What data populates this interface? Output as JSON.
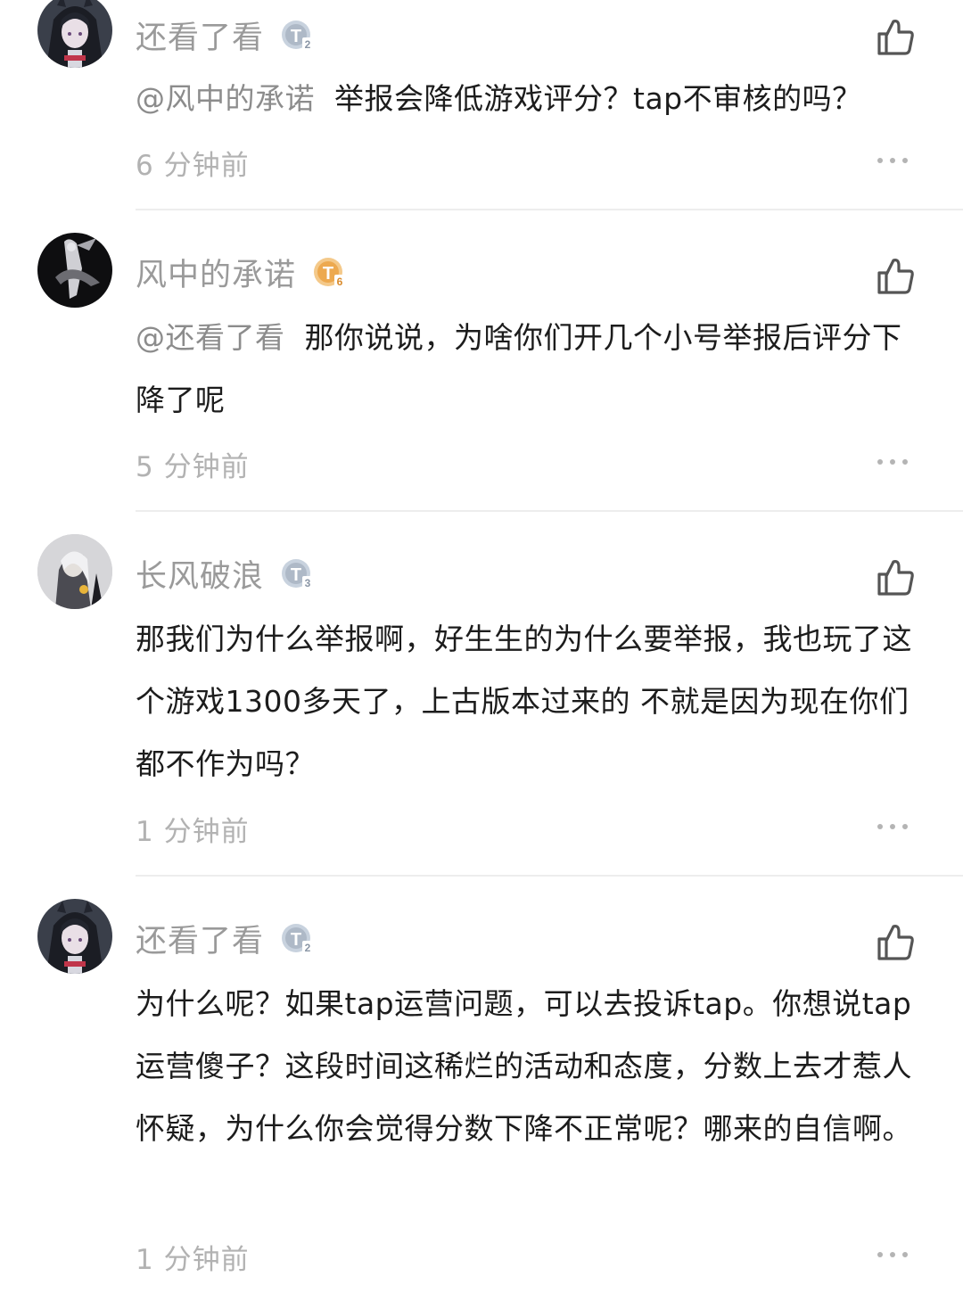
{
  "comments": [
    {
      "username": "还看了看",
      "level": "2",
      "badge_color": "#c8d2de",
      "mention": "@风中的承诺",
      "text": "举报会降低游戏评分？tap不审核的吗？",
      "time": "6 分钟前",
      "avatar_icon": "anime-girl-avatar"
    },
    {
      "username": "风中的承诺",
      "level": "6",
      "badge_color": "#f0b466",
      "mention": "@还看了看",
      "text": "那你说说，为啥你们开几个小号举报后评分下降了呢",
      "time": "5 分钟前",
      "avatar_icon": "dark-figure-avatar"
    },
    {
      "username": "长风破浪",
      "level": "3",
      "badge_color": "#c8d2de",
      "mention": "",
      "text": "那我们为什么举报啊，好生生的为什么要举报，我也玩了这个游戏1300多天了，上古版本过来的 不就是因为现在你们都不作为吗？",
      "time": "1 分钟前",
      "avatar_icon": "grey-character-avatar"
    },
    {
      "username": "还看了看",
      "level": "2",
      "badge_color": "#c8d2de",
      "mention": "",
      "text": "为什么呢？如果tap运营问题，可以去投诉tap。你想说tap运营傻子？这段时间这稀烂的活动和态度，分数上去才惹人怀疑，为什么你会觉得分数下降不正常呢？哪来的自信啊。",
      "time": "1 分钟前",
      "avatar_icon": "anime-girl-avatar"
    }
  ],
  "icons": {
    "like": "thumbs-up-icon",
    "more": "more-dots-icon",
    "level": "level-badge-icon"
  }
}
